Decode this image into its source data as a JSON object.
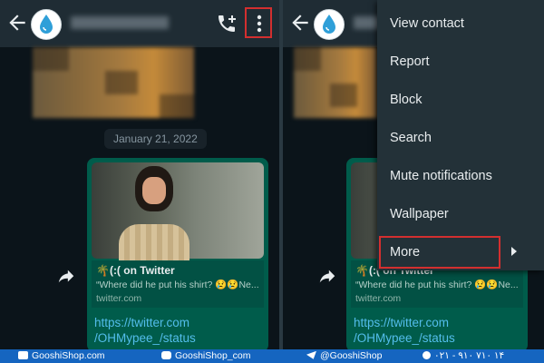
{
  "chat": {
    "date": "January 21, 2022",
    "link_title": "🌴(:( on Twitter",
    "link_desc": "“Where did he put his shirt? 😢😢Ne...",
    "link_domain": "twitter.com",
    "url_line1": "https://twitter.com",
    "url_line2": "/OHMypee_/status"
  },
  "menu": {
    "items": [
      "View contact",
      "Report",
      "Block",
      "Search",
      "Mute notifications",
      "Wallpaper",
      "More"
    ]
  },
  "footer": {
    "website": "GooshiShop.com",
    "instagram": "GooshiShop_com",
    "telegram": "@GooshiShop",
    "phone": "۰۲۱ - ۹۱۰ ۷۱۰ ۱۴"
  },
  "icons": {
    "back": "arrow-back-icon",
    "call": "call-add-icon",
    "menu": "more-vert-icon",
    "forward": "forward-icon"
  },
  "colors": {
    "accent": "#00a884",
    "bubble": "#005c4b",
    "highlight": "#d32f2f",
    "link": "#53bdeb",
    "footer": "#1565c0"
  }
}
